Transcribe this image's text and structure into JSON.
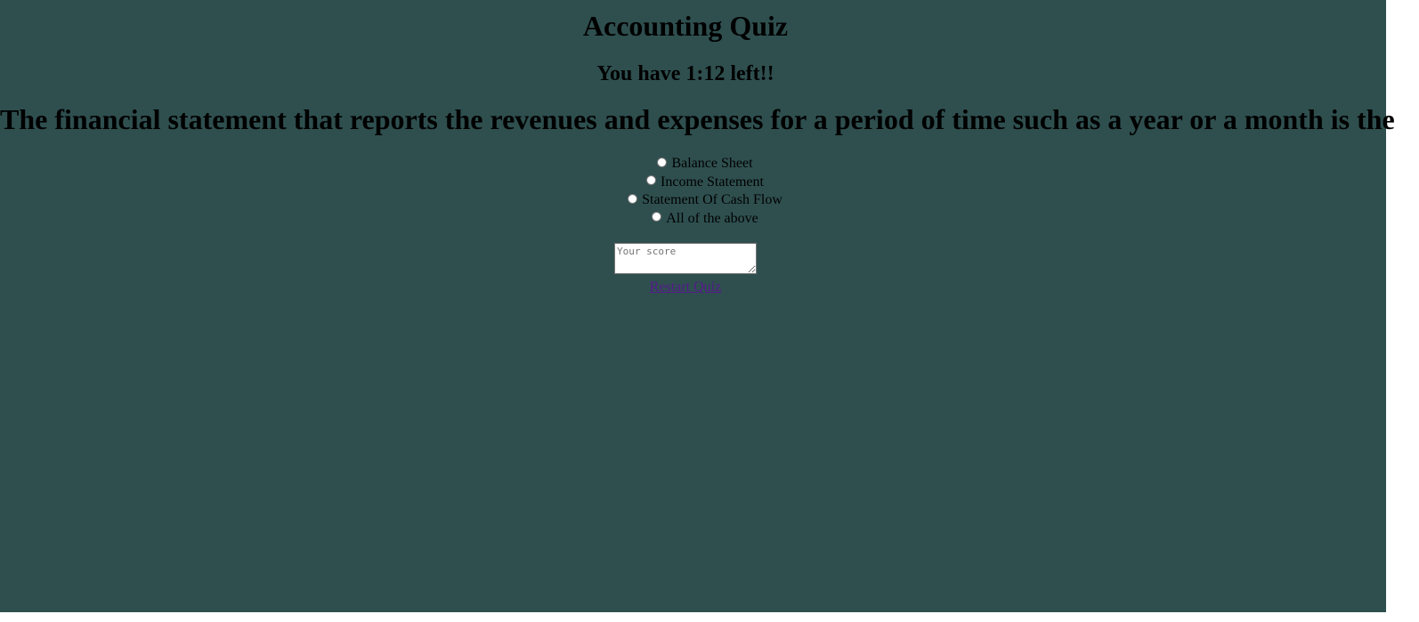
{
  "quiz": {
    "title": "Accounting Quiz",
    "timer_text": "You have 1:12 left!!",
    "question": "The financial statement that reports the revenues and expenses for a period of time such as a year or a month is the",
    "options": [
      "Balance Sheet",
      "Income Statement",
      "Statement Of Cash Flow",
      "All of the above"
    ],
    "score_placeholder": "Your score",
    "restart_label": "Restart Quiz"
  },
  "colors": {
    "background": "#2f4f4f",
    "text": "#000000",
    "link_visited": "#551a8b"
  }
}
